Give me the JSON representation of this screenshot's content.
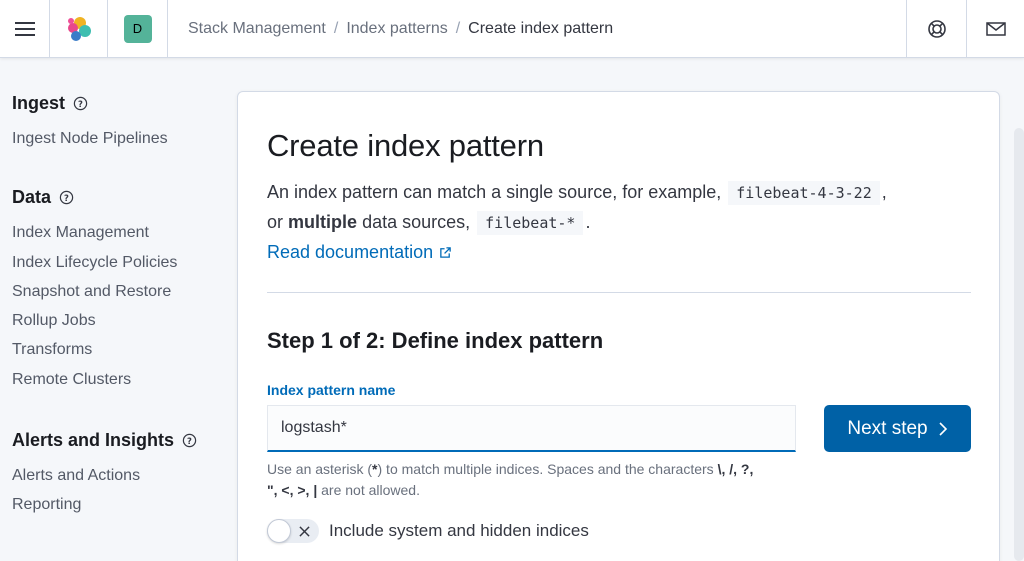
{
  "header": {
    "menu_icon": "hamburger-menu-icon",
    "logo_icon": "elastic-logo-icon",
    "space_initial": "D",
    "breadcrumbs": [
      "Stack Management",
      "Index patterns",
      "Create index pattern"
    ],
    "breadcrumb_separator": "/",
    "help_icon": "lifebuoy-icon",
    "mail_icon": "mail-icon"
  },
  "sidebar": {
    "sections": [
      {
        "title": "Ingest",
        "items": [
          "Ingest Node Pipelines"
        ]
      },
      {
        "title": "Data",
        "items": [
          "Index Management",
          "Index Lifecycle Policies",
          "Snapshot and Restore",
          "Rollup Jobs",
          "Transforms",
          "Remote Clusters"
        ]
      },
      {
        "title": "Alerts and Insights",
        "items": [
          "Alerts and Actions",
          "Reporting"
        ]
      }
    ]
  },
  "main": {
    "title": "Create index pattern",
    "description": {
      "part1": "An index pattern can match a single source, for example,",
      "code1": "filebeat-4-3-22",
      "part2": ",",
      "part3": "or",
      "bold": "multiple",
      "part4": "data sources,",
      "code2": "filebeat-*",
      "part5": "."
    },
    "doc_link": "Read documentation",
    "step_title": "Step 1 of 2: Define index pattern",
    "field_label": "Index pattern name",
    "field_value": "logstash*",
    "next_button": "Next step",
    "help_text": {
      "line1": "Use an asterisk (",
      "asterisk": "*",
      "line2": ") to match multiple indices. Spaces and the characters",
      "chars_a": "\\, /, ?,",
      "chars_b": "\", <, >, |",
      "line3": "are not allowed."
    },
    "toggle_label": "Include system and hidden indices",
    "toggle_on": false
  },
  "colors": {
    "accent": "#006bb8",
    "button": "#0061a6",
    "space_avatar": "#54b399"
  }
}
